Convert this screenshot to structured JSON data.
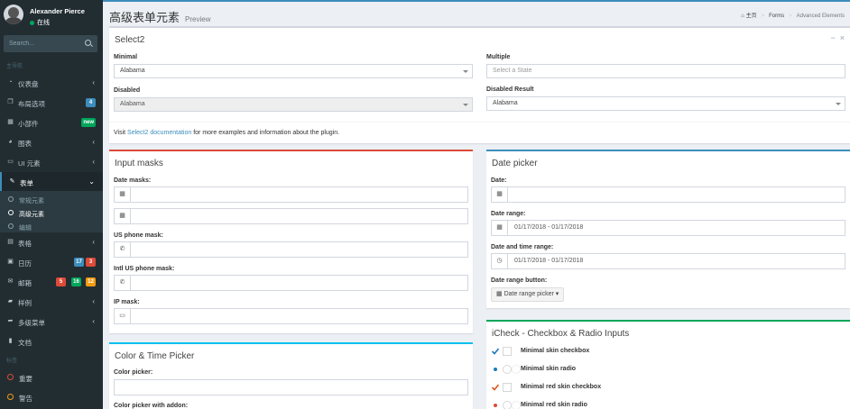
{
  "user": {
    "name": "Alexander Pierce",
    "status": "在线"
  },
  "search": {
    "placeholder": "Search..."
  },
  "sidebar": {
    "header_main": "主导航",
    "items": [
      {
        "label": "仪表盘",
        "icon": "dashboard-icon"
      },
      {
        "label": "布局选项",
        "icon": "files-icon",
        "badge": "4"
      },
      {
        "label": "小部件",
        "icon": "th-icon",
        "badge": "new"
      },
      {
        "label": "图表",
        "icon": "pie-chart-icon"
      },
      {
        "label": "UI 元素",
        "icon": "laptop-icon"
      },
      {
        "label": "表单",
        "icon": "edit-icon"
      },
      {
        "label": "表格",
        "icon": "table-icon"
      },
      {
        "label": "日历",
        "icon": "calendar-icon",
        "badges": [
          "17",
          "3"
        ]
      },
      {
        "label": "邮箱",
        "icon": "envelope-icon",
        "badges": [
          "5",
          "16",
          "12"
        ]
      },
      {
        "label": "样例",
        "icon": "folder-icon"
      },
      {
        "label": "多级菜单",
        "icon": "share-icon"
      },
      {
        "label": "文档",
        "icon": "book-icon"
      }
    ],
    "sub_items": [
      "常规元素",
      "高级元素",
      "编辑"
    ],
    "header_labels": "标签",
    "labels": [
      {
        "label": "重要",
        "color": "#dd4b39"
      },
      {
        "label": "警告",
        "color": "#f39c12"
      }
    ],
    "colors": {
      "badge_blue": "#3c8dbc",
      "badge_green": "#00a65a",
      "badge_red": "#dd4b39",
      "badge_yellow": "#f39c12"
    }
  },
  "page": {
    "title": "高级表单元素",
    "subtitle": "Preview"
  },
  "breadcrumb": {
    "home": "主页",
    "forms": "Forms",
    "current": "Advanced Elements"
  },
  "select2": {
    "title": "Select2",
    "minimal_label": "Minimal",
    "minimal_value": "Alabama",
    "multiple_label": "Multiple",
    "multiple_placeholder": "Select a State",
    "disabled_label": "Disabled",
    "disabled_value": "Alabama",
    "disabled_result_label": "Disabled Result",
    "disabled_result_value": "Alabama",
    "footer_pre": "Visit ",
    "footer_link": "Select2 documentation",
    "footer_post": " for more examples and information about the plugin."
  },
  "input_masks": {
    "title": "Input masks",
    "date_label": "Date masks:",
    "us_phone_label": "US phone mask:",
    "intl_phone_label": "Intl US phone mask:",
    "ip_label": "IP mask:"
  },
  "color_picker": {
    "title": "Color & Time Picker",
    "picker_label": "Color picker:",
    "addon_label": "Color picker with addon:"
  },
  "date_picker": {
    "title": "Date picker",
    "date_label": "Date:",
    "range_label": "Date range:",
    "range_value": "01/17/2018 - 01/17/2018",
    "time_range_label": "Date and time range:",
    "time_range_value": "01/17/2018 - 01/17/2018",
    "button_label": "Date range button:",
    "button_text": "Date range picker"
  },
  "icheck": {
    "title": "iCheck - Checkbox & Radio Inputs",
    "rows": [
      "Minimal skin checkbox",
      "Minimal skin radio",
      "Minimal red skin checkbox",
      "Minimal red skin radio"
    ]
  }
}
